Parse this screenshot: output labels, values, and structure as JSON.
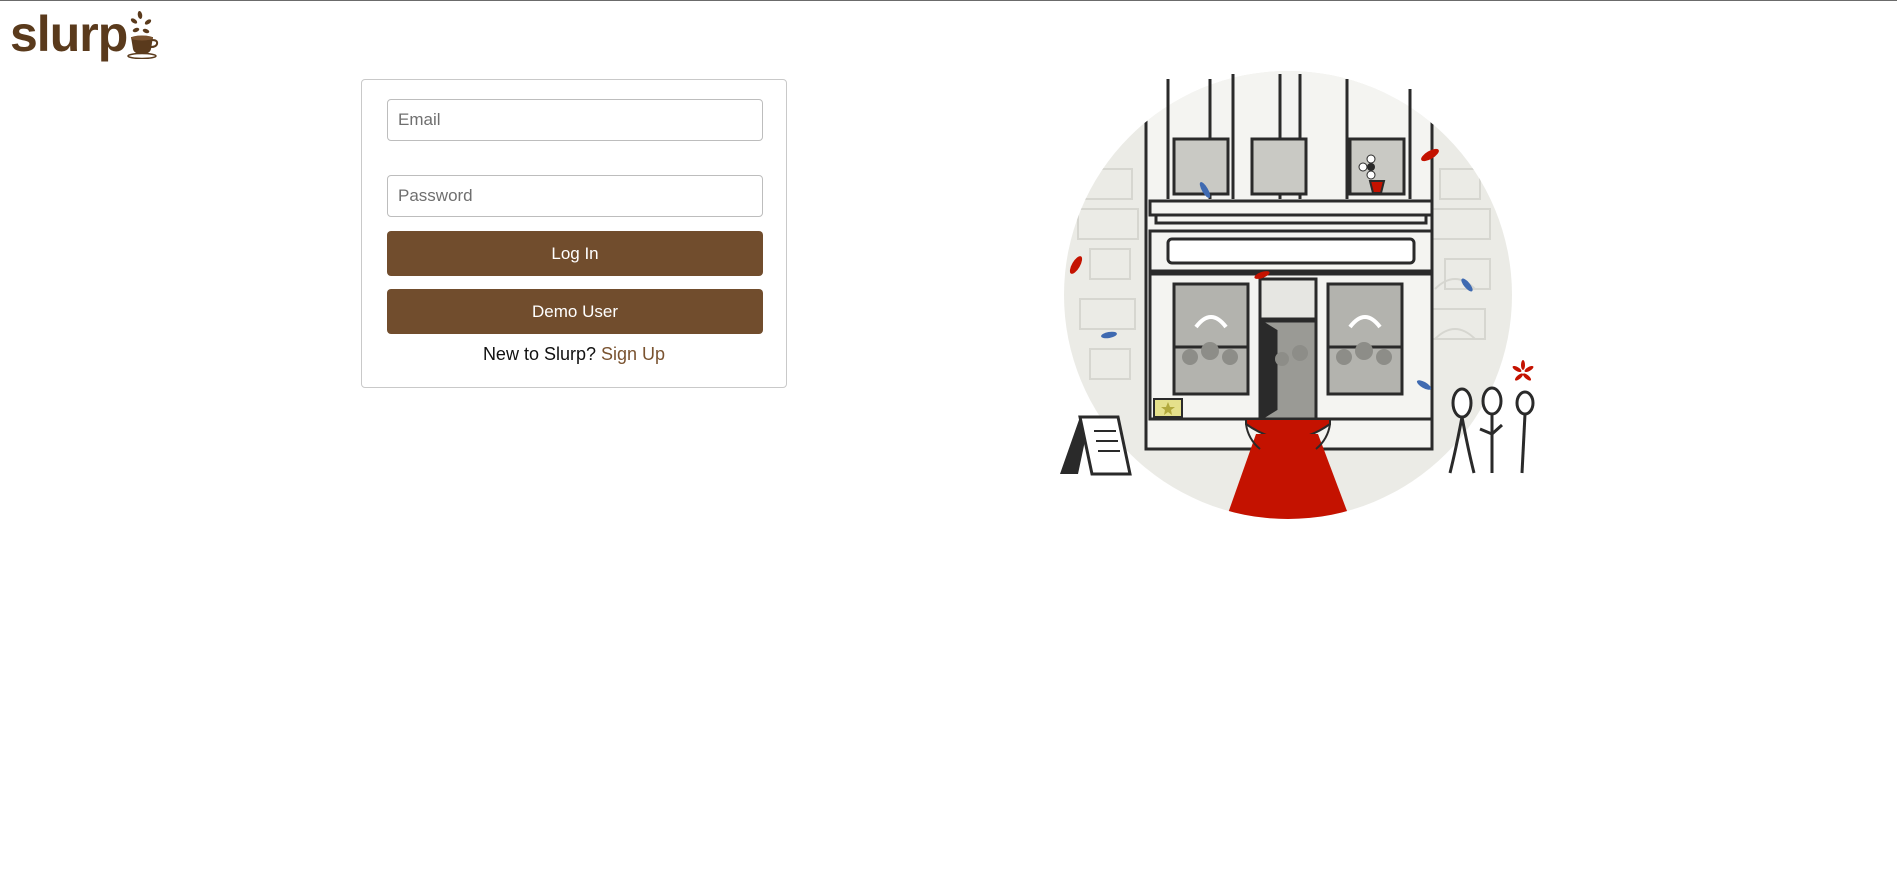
{
  "app": {
    "logo_text": "slurp",
    "logo_icon": "coffee-cup-icon"
  },
  "login_form": {
    "email": {
      "value": "",
      "placeholder": "Email"
    },
    "password": {
      "value": "",
      "placeholder": "Password"
    },
    "login_button_label": "Log In",
    "demo_button_label": "Demo User",
    "signup_prompt": "New to Slurp?",
    "signup_link_label": "Sign Up"
  },
  "illustration": {
    "name": "storefront-grand-opening-illustration"
  },
  "colors": {
    "brand_brown": "#714d2d",
    "logo_brown": "#5a3a1c",
    "link_brown": "#7a5330",
    "carpet_red": "#c41200",
    "confetti_blue": "#3f6ab1"
  }
}
